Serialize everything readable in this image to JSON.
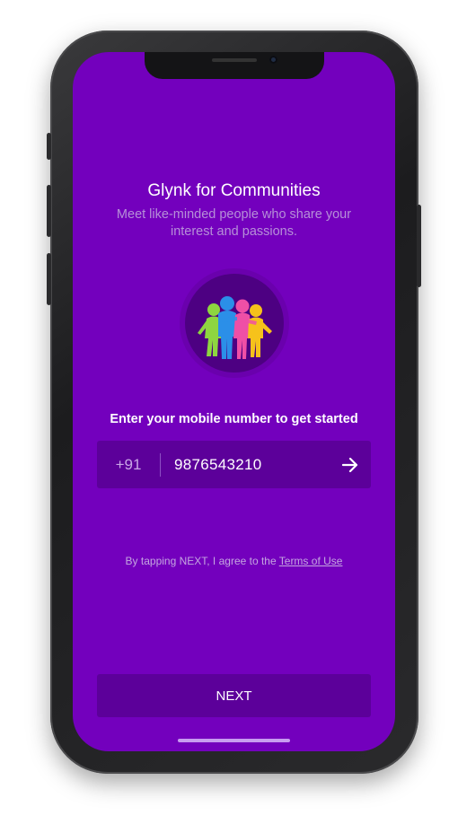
{
  "onboarding": {
    "title": "Glynk for Communities",
    "subtitle": "Meet like-minded people who share your interest and passions.",
    "illustration_icon": "community-people-icon",
    "prompt": "Enter your mobile number to get started"
  },
  "phone_input": {
    "country_code": "+91",
    "value": "9876543210",
    "submit_icon": "arrow-right-icon"
  },
  "terms": {
    "prefix": "By tapping NEXT, I agree to the ",
    "link": "Terms of Use"
  },
  "next_button": {
    "label": "NEXT"
  },
  "colors": {
    "background": "#7300bd",
    "surface": "#5c009a",
    "text": "#ffffff",
    "muted_text": "#b690d8"
  }
}
